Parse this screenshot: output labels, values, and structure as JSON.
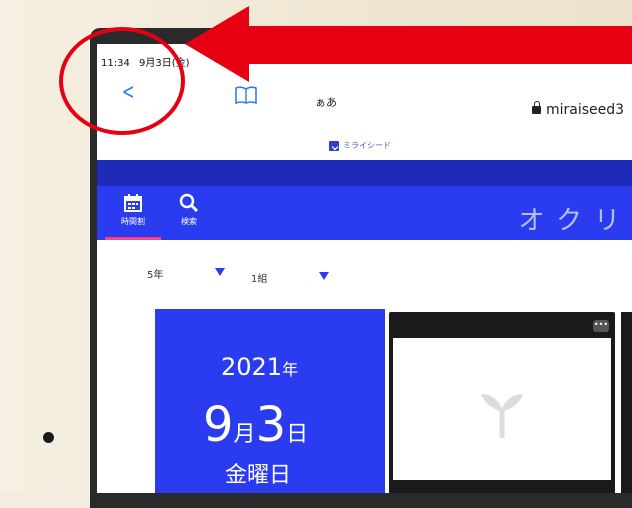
{
  "status_bar": {
    "time": "11:34",
    "date": "9月3日(金)"
  },
  "browser": {
    "back_label": "<",
    "reader_label": "ぁあ",
    "url": "miraiseed3"
  },
  "site": {
    "brand": "ミライシード",
    "nav": [
      {
        "label": "時間割",
        "icon": "calendar-icon"
      },
      {
        "label": "検索",
        "icon": "search-icon"
      }
    ],
    "app_title": "オクリ"
  },
  "selectors": {
    "grade": "5年",
    "class": "1組"
  },
  "date_card": {
    "year": "2021",
    "year_unit": "年",
    "month": "9",
    "month_unit": "月",
    "day": "3",
    "day_unit": "日",
    "weekday": "金曜日"
  },
  "class_card": {
    "more_label": "•••"
  },
  "colors": {
    "accent": "#2b3cf0",
    "accent_dark": "#1e2ab8",
    "annotation": "#e60012",
    "active_tab": "#ff3e86"
  }
}
